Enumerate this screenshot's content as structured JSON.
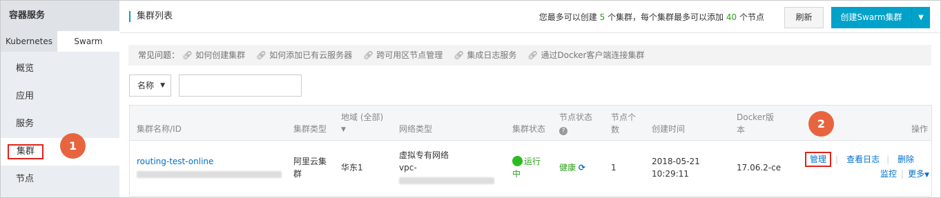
{
  "sidebar": {
    "title": "容器服务",
    "tabs": [
      "Kubernetes",
      "Swarm"
    ],
    "items": [
      "概览",
      "应用",
      "服务",
      "集群",
      "节点"
    ]
  },
  "badges": [
    "1",
    "2"
  ],
  "header": {
    "title": "集群列表",
    "info_prefix": "您最多可以创建",
    "max_clusters": "5",
    "info_mid": "个集群，每个集群最多可以添加",
    "max_nodes": "40",
    "info_suffix": "个节点",
    "refresh_label": "刷新",
    "create_label": "创建Swarm集群"
  },
  "faq": {
    "label": "常见问题：",
    "links": [
      "如何创建集群",
      "如何添加已有云服务器",
      "跨可用区节点管理",
      "集成日志服务",
      "通过Docker客户端连接集群"
    ]
  },
  "filter": {
    "select_value": "名称",
    "search_value": ""
  },
  "table": {
    "headers": {
      "name": "集群名称/ID",
      "type": "集群类型",
      "region": "地域 (全部)",
      "network": "网络类型",
      "status": "集群状态",
      "node_status": "节点状态",
      "node_count": "节点个数",
      "created": "创建时间",
      "docker_version": "Docker版本",
      "actions": "操作"
    },
    "rows": [
      {
        "name": "routing-test-online",
        "type": "阿里云集群",
        "region": "华东1",
        "network": "虚拟专有网络",
        "network_id_prefix": "vpc-",
        "status": "运行中",
        "node_status": "健康",
        "node_count": "1",
        "created_date": "2018-05-21",
        "created_time": "10:29:11",
        "docker_version": "17.06.2-ce",
        "actions": [
          "管理",
          "查看日志",
          "删除",
          "监控",
          "更多"
        ]
      }
    ]
  },
  "colors": {
    "accent": "#00a2ca",
    "link": "#0070cc",
    "success": "#2aa11a",
    "annotation": "#e0211b",
    "badge": "#e8643f"
  }
}
